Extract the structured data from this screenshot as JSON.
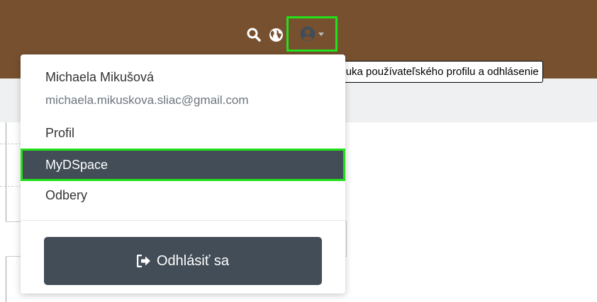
{
  "header": {
    "background_color": "#77512f",
    "icons": [
      "search-icon",
      "globe-icon",
      "user-circle-icon",
      "caret-down-icon"
    ]
  },
  "tooltip": {
    "text": "Ponuka používateľského profilu a odhlásenie"
  },
  "dropdown": {
    "user_name": "Michaela Mikušová",
    "user_email": "michaela.mikuskova.sliac@gmail.com",
    "items": [
      {
        "label": "Profil"
      },
      {
        "label": "MyDSpace",
        "highlighted": true
      },
      {
        "label": "Odbery"
      }
    ],
    "logout_label": "Odhlásiť sa",
    "logout_icon": "sign-out-icon"
  },
  "colors": {
    "highlight_outline": "#22e11a",
    "dark_button": "#434d57"
  }
}
